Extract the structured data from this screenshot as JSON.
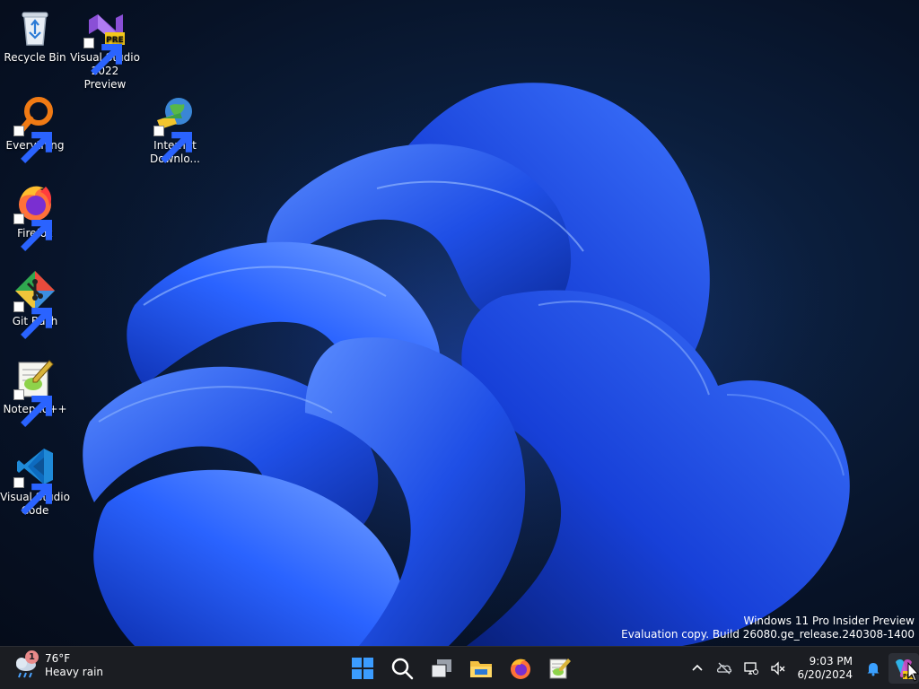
{
  "desktop": {
    "icons": [
      {
        "label": "Recycle Bin",
        "icon": "recycle-bin-icon"
      },
      {
        "label": "Visual Studio 2022 Preview",
        "icon": "visual-studio-preview-icon",
        "badge": "PRE"
      },
      {
        "label": "Everything",
        "icon": "everything-search-icon"
      },
      {
        "label": "Internet Downlo...",
        "icon": "internet-download-manager-icon"
      },
      {
        "label": "Firefox",
        "icon": "firefox-icon"
      },
      {
        "label": "Git Bash",
        "icon": "git-bash-icon"
      },
      {
        "label": "Notepad++",
        "icon": "notepad-plus-plus-icon"
      },
      {
        "label": "Visual Studio Code",
        "icon": "vscode-icon"
      }
    ],
    "watermark": {
      "line1": "Windows 11 Pro Insider Preview",
      "line2": "Evaluation copy. Build 26080.ge_release.240308-1400"
    }
  },
  "taskbar": {
    "weather": {
      "badge": "1",
      "temperature": "76°F",
      "condition": "Heavy rain",
      "icon": "weather-rain-icon"
    },
    "pinned": [
      {
        "name": "start-button",
        "icon": "windows-logo-icon"
      },
      {
        "name": "search-button",
        "icon": "search-icon"
      },
      {
        "name": "task-view-button",
        "icon": "task-view-icon"
      },
      {
        "name": "file-explorer-button",
        "icon": "folder-icon"
      },
      {
        "name": "firefox-taskbar-button",
        "icon": "firefox-icon"
      },
      {
        "name": "notepad-plus-plus-taskbar-button",
        "icon": "notepad-plus-plus-icon"
      }
    ],
    "tray": {
      "icons": [
        "chevron-up-icon",
        "onedrive-offline-icon",
        "network-icon",
        "volume-muted-icon"
      ],
      "time": "9:03 PM",
      "date": "6/20/2024",
      "notification_icon": "bell-icon",
      "copilot_badge": "PRE"
    }
  },
  "colors": {
    "taskbar": "#1b1d22",
    "wallpaper_dark": "#071226",
    "wallpaper_accent": "#1f5cff"
  }
}
